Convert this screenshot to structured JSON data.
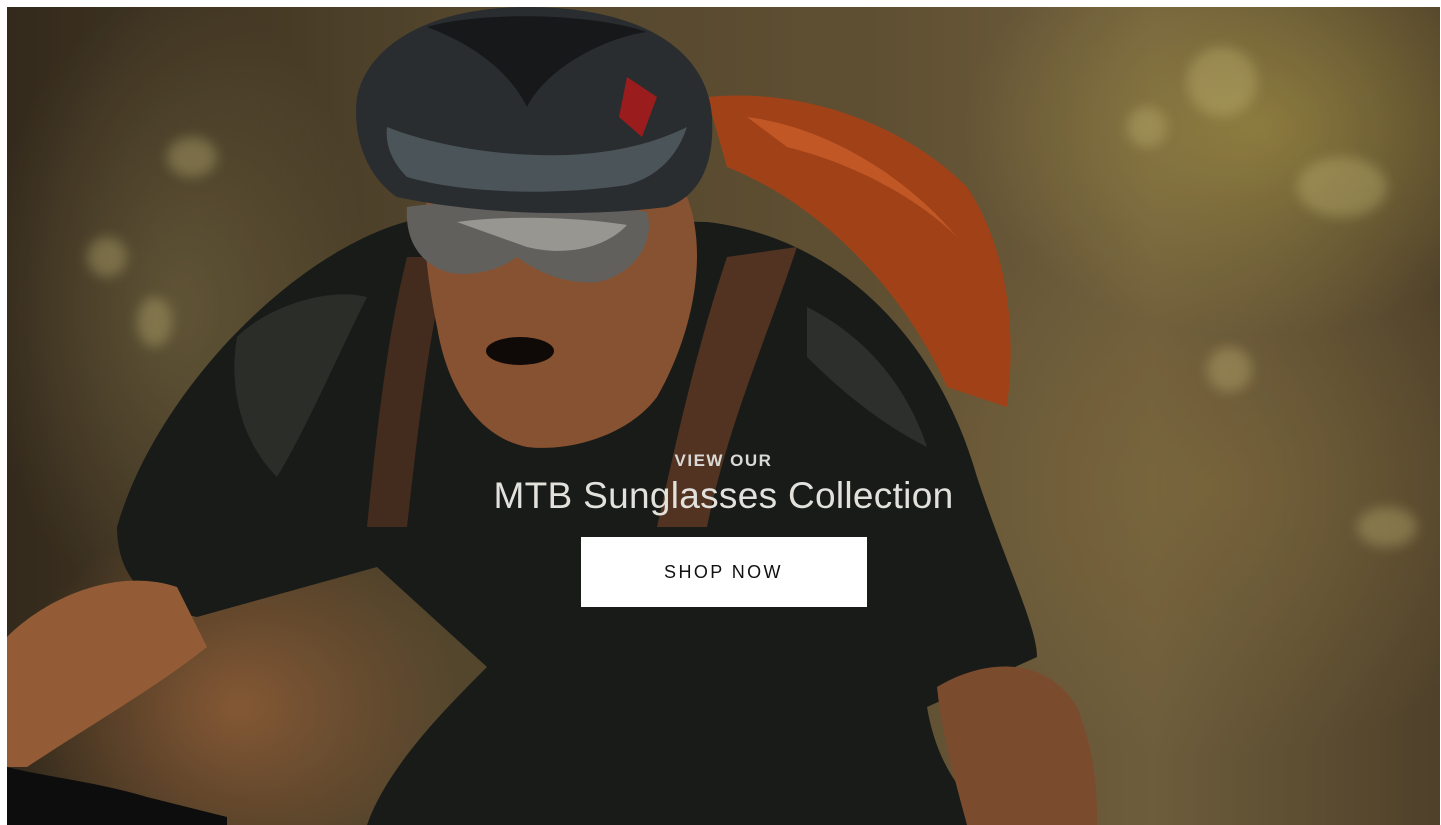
{
  "hero": {
    "eyebrow": "VIEW OUR",
    "title": "MTB Sunglasses Collection",
    "cta_label": "SHOP NOW",
    "image_subject": "mountain-biker-wearing-sunglasses-photo"
  },
  "colors": {
    "cta_background": "#ffffff",
    "cta_text": "#111111",
    "heading_text": "#e2e1dc",
    "eyebrow_text": "#d9d9d6"
  }
}
